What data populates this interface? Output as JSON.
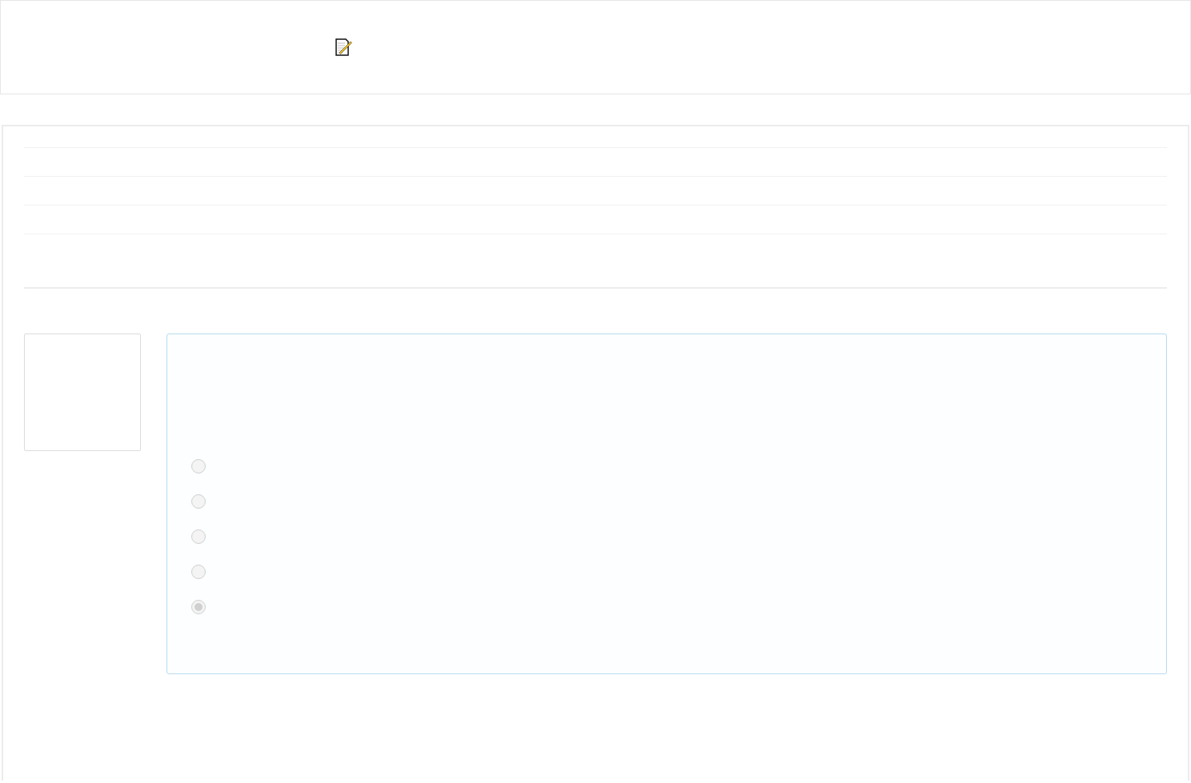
{
  "question": {
    "options": [
      {
        "selected": false
      },
      {
        "selected": false
      },
      {
        "selected": false
      },
      {
        "selected": false
      },
      {
        "selected": true
      }
    ]
  }
}
